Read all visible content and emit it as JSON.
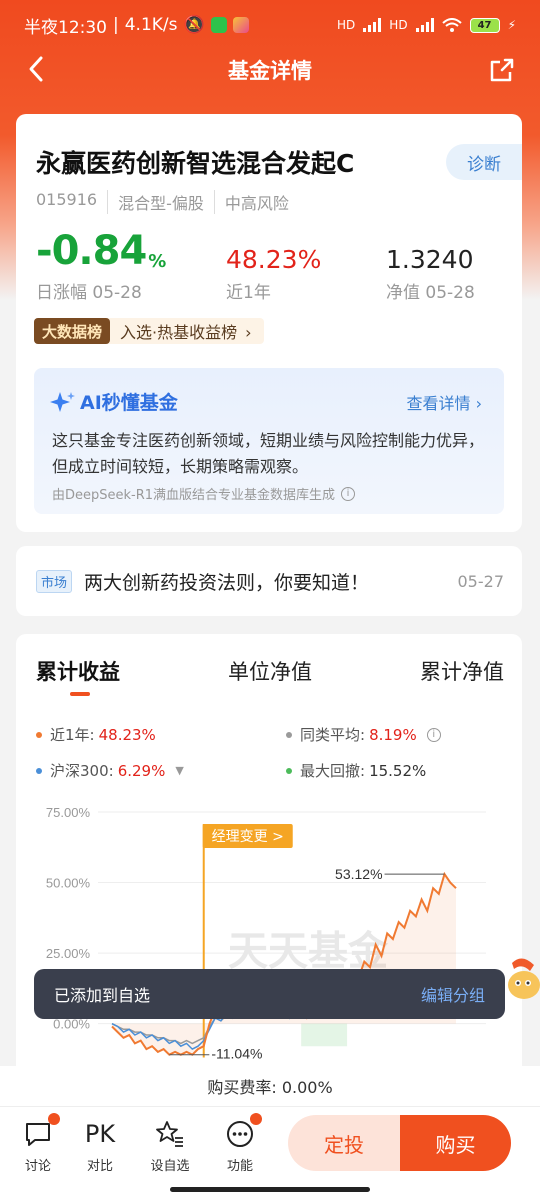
{
  "status_bar": {
    "time": "半夜12:30",
    "speed": "4.1K/s",
    "hd1": "HD",
    "hd2": "HD",
    "battery": "47"
  },
  "nav": {
    "title": "基金详情"
  },
  "fund": {
    "name": "永赢医药创新智选混合发起C",
    "diagnose_label": "诊断",
    "code": "015916",
    "type": "混合型-偏股",
    "risk": "中高风险",
    "daily_change": "-0.84",
    "daily_change_unit": "%",
    "daily_change_label": "日涨幅 05-28",
    "year_return": "48.23%",
    "year_return_label": "近1年",
    "nav_value": "1.3240",
    "nav_label": "净值 05-28",
    "rank_badge": "大数据榜",
    "rank_text": "入选·热基收益榜"
  },
  "ai": {
    "title": "AI秒懂基金",
    "more": "查看详情",
    "text": "这只基金专注医药创新领域，短期业绩与风险控制能力优异，但成立时间较短，长期策略需观察。",
    "source": "由DeepSeek-R1满血版结合专业基金数据库生成"
  },
  "news": {
    "tag": "市场",
    "title": "两大创新药投资法则，你要知道！",
    "date": "05-27"
  },
  "chart_tabs": [
    "累计收益",
    "单位净值",
    "累计净值"
  ],
  "legend": {
    "fund_label": "近1年:",
    "fund_value": "48.23%",
    "avg_label": "同类平均:",
    "avg_value": "8.19%",
    "index_label": "沪深300:",
    "index_value": "6.29%",
    "drawdown_label": "最大回撤:",
    "drawdown_value": "15.52%"
  },
  "chart_data": {
    "type": "line",
    "ylim": [
      -15,
      75
    ],
    "yticks": [
      "75.00%",
      "50.00%",
      "25.00%",
      "0.00%"
    ],
    "annotation_manager": "经理变更 >",
    "annotation_max": "53.12%",
    "annotation_min": "-11.04%",
    "watermark": "天天基金",
    "series": [
      {
        "name": "近1年",
        "color": "#f07a32",
        "values": [
          -1,
          -3,
          -5,
          -4,
          -7,
          -6,
          -9,
          -8,
          -10,
          -9,
          -11,
          -10,
          -11,
          -10,
          -11,
          -9,
          -8,
          0,
          5,
          3,
          8,
          4,
          12,
          6,
          4,
          10,
          7,
          5,
          10,
          6,
          8,
          3,
          9,
          5,
          2,
          4,
          8,
          6,
          12,
          10,
          15,
          12,
          18,
          16,
          22,
          20,
          28,
          24,
          32,
          30,
          36,
          34,
          40,
          38,
          44,
          40,
          48,
          46,
          53,
          50,
          48
        ]
      },
      {
        "name": "沪深300",
        "color": "#4a8fd8",
        "values": [
          0,
          -1,
          -3,
          -2,
          -4,
          -3,
          -5,
          -4,
          -6,
          -5,
          -7,
          -6,
          -8,
          -7,
          -9,
          -8,
          -6,
          -2,
          2,
          1,
          4,
          2,
          6,
          3,
          2,
          5,
          4,
          3,
          6,
          4,
          5,
          2,
          6,
          4,
          3,
          5,
          6,
          5,
          7,
          6,
          8,
          7,
          6,
          7,
          5,
          6,
          4,
          5,
          2,
          4,
          6,
          5,
          7,
          6,
          6,
          5,
          7,
          6,
          6,
          5,
          6
        ]
      },
      {
        "name": "同类平均",
        "color": "#9a9a9a",
        "values": [
          0,
          -1,
          -2,
          -2,
          -3,
          -3,
          -4,
          -4,
          -5,
          -5,
          -6,
          -6,
          -7,
          -6,
          -7,
          -6,
          -5,
          -1,
          2,
          1,
          3,
          2,
          5,
          3,
          2,
          4,
          3,
          3,
          5,
          3,
          4,
          2,
          5,
          3,
          2,
          4,
          5,
          4,
          6,
          5,
          7,
          6,
          7,
          6,
          7,
          7,
          8,
          7,
          8,
          8,
          9,
          8,
          8,
          9,
          8,
          8,
          9,
          8,
          8,
          8,
          8
        ]
      }
    ]
  },
  "toast": {
    "message": "已添加到自选",
    "action": "编辑分组"
  },
  "fee": "购买费率: 0.00%",
  "bottom": {
    "discuss": "讨论",
    "pk": "PK",
    "compare": "对比",
    "watch": "设自选",
    "func": "功能",
    "dingtou": "定投",
    "buy": "购买"
  },
  "colors": {
    "accent": "#f0501f",
    "up": "#e2231a",
    "down": "#18a33a",
    "link": "#3a7fd0"
  }
}
